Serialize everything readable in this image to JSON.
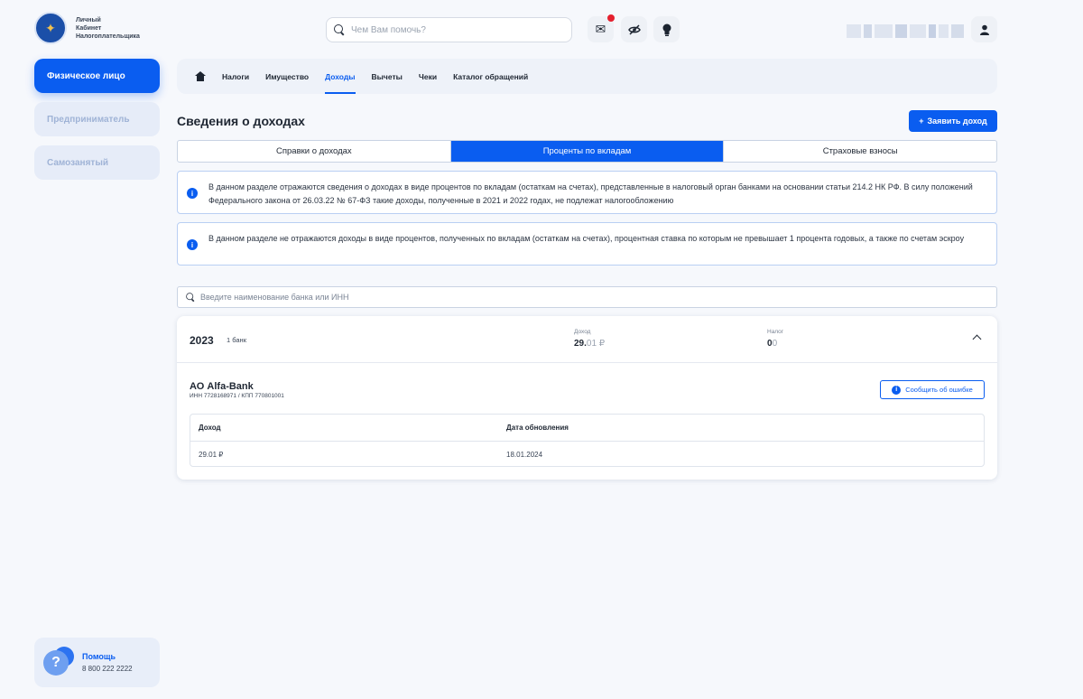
{
  "header": {
    "logo_lines": [
      "Личный",
      "Кабинет",
      "Налогоплательщика"
    ],
    "search_placeholder": "Чем Вам помочь?",
    "user_name_masked": ""
  },
  "sidebar": {
    "items": [
      {
        "label": "Физическое лицо",
        "active": true
      },
      {
        "label": "Предприниматель",
        "active": false
      },
      {
        "label": "Самозанятый",
        "active": false
      }
    ],
    "help": {
      "title": "Помощь",
      "phone": "8 800 222 2222"
    }
  },
  "nav": {
    "items": [
      "Налоги",
      "Имущество",
      "Доходы",
      "Вычеты",
      "Чеки",
      "Каталог обращений"
    ],
    "active": "Доходы"
  },
  "main": {
    "title": "Сведения о доходах",
    "add_button": "Заявить доход",
    "tabs": [
      "Справки о доходах",
      "Проценты по вкладам",
      "Страховые взносы"
    ],
    "active_tab": "Проценты по вкладам",
    "info_1": "В данном разделе отражаются сведения о доходах в виде процентов по вкладам (остаткам на счетах), представленные в налоговый орган банками на основании статьи 214.2 НК РФ. В силу положений Федерального закона от 26.03.22 № 67-ФЗ такие доходы, полученные в 2021 и 2022 годах, не подлежат налогообложению",
    "info_2": "В данном разделе не отражаются доходы в виде процентов, полученных по вкладам (остаткам на счетах), процентная ставка по которым не превышает 1 процента годовых, а также по счетам эскроу",
    "bank_search_placeholder": "Введите наименование банка или ИНН"
  },
  "year_card": {
    "year": "2023",
    "bank_count": "1 банк",
    "income_label": "Доход",
    "income_main": "29.",
    "income_frac": "01 ₽",
    "tax_label": "Налог",
    "tax_main": "0",
    "tax_frac": "0",
    "bank": {
      "name": "АО Alfa-Bank",
      "ids": "ИНН 7728168971 / КПП 770801001",
      "report_button": "Сообщить об ошибке"
    },
    "table": {
      "headers": [
        "Доход",
        "Дата обновления"
      ],
      "rows": [
        [
          "29.01 ₽",
          "18.01.2024"
        ]
      ]
    }
  },
  "colors": {
    "accent": "#0a5df0",
    "background": "#f6f8fc",
    "notification": "#e5202e"
  }
}
